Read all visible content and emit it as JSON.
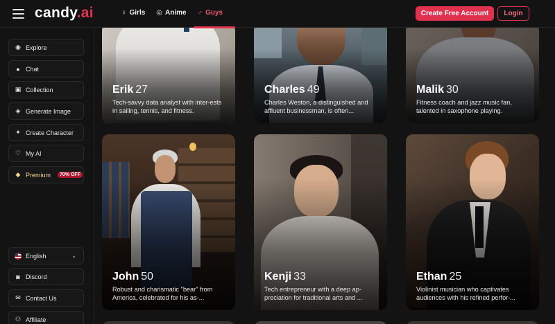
{
  "brand": {
    "name": "candy",
    "dot": ".",
    "suffix": "ai"
  },
  "nav": [
    {
      "label": "Girls",
      "icon": "female-icon"
    },
    {
      "label": "Anime",
      "icon": "anime-icon"
    },
    {
      "label": "Guys",
      "icon": "male-icon",
      "active": true
    }
  ],
  "header": {
    "create_label": "Create Free Account",
    "login_label": "Login"
  },
  "sidebar": {
    "items": [
      {
        "label": "Explore",
        "icon": "compass-icon"
      },
      {
        "label": "Chat",
        "icon": "chat-icon"
      },
      {
        "label": "Collection",
        "icon": "collection-icon"
      },
      {
        "label": "Generate Image",
        "icon": "image-icon"
      },
      {
        "label": "Create Character",
        "icon": "wand-icon"
      },
      {
        "label": "My AI",
        "icon": "heart-icon"
      },
      {
        "label": "Premium",
        "icon": "diamond-icon",
        "badge": "70% OFF"
      }
    ],
    "bottom": [
      {
        "label": "English",
        "icon": "us-flag-icon"
      },
      {
        "label": "Discord",
        "icon": "discord-icon"
      },
      {
        "label": "Contact Us",
        "icon": "contact-icon"
      },
      {
        "label": "Affiliate",
        "icon": "affiliate-icon"
      }
    ]
  },
  "cards": [
    {
      "name": "Erik",
      "age": "27",
      "desc": "Tech-savvy data analyst with inter-ests in sailing, tennis, and fitness."
    },
    {
      "name": "Charles",
      "age": "49",
      "desc": "Charles Weston, a distinguished and affluent businessman, is often..."
    },
    {
      "name": "Malik",
      "age": "30",
      "desc": "Fitness coach and jazz music fan, talented in saxophone playing."
    },
    {
      "name": "John",
      "age": "50",
      "desc": "Robust and charismatic \"bear\" from America, celebrated for his as-..."
    },
    {
      "name": "Kenji",
      "age": "33",
      "desc": "Tech entrepreneur with a deep ap-preciation for traditional arts and ..."
    },
    {
      "name": "Ethan",
      "age": "25",
      "desc": "Violinist musician who captivates audiences with his refined perfor-..."
    }
  ],
  "colors": {
    "accent": "#e0324f",
    "background": "#131313",
    "premium": "#f4d78a"
  }
}
